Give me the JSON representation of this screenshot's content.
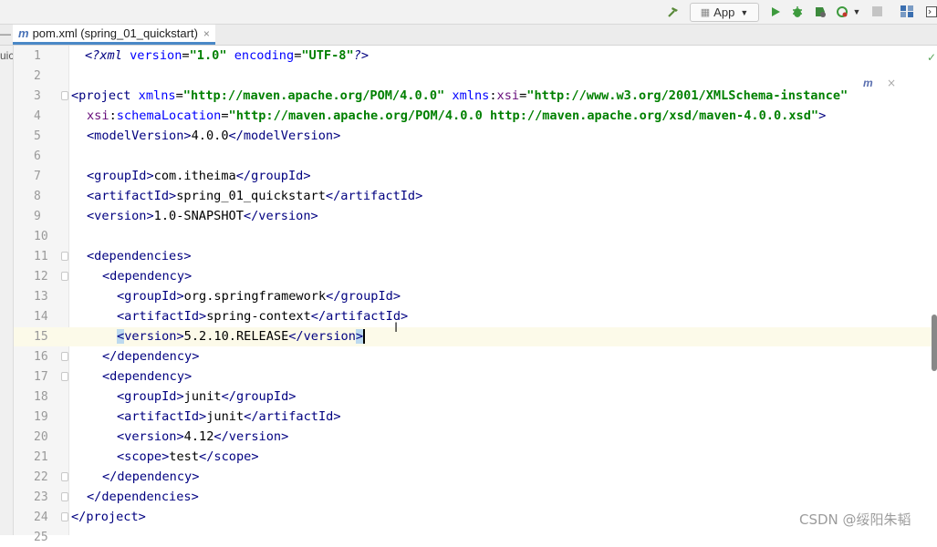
{
  "toolbar": {
    "run_config": "App",
    "icons": [
      "hammer-icon",
      "run-icon",
      "debug-icon",
      "coverage-icon",
      "profile-icon",
      "stop-icon",
      "project-structure-icon",
      "terminal-icon"
    ]
  },
  "tab": {
    "icon_letter": "m",
    "title": "pom.xml (spring_01_quickstart)",
    "close": "×"
  },
  "strip": {
    "label": "uic"
  },
  "overlay": {
    "maven_badge": "m",
    "badge_close": "×",
    "check": "✓"
  },
  "watermark": "CSDN @绥阳朱韬",
  "lines": [
    "1",
    "2",
    "3",
    "4",
    "5",
    "6",
    "7",
    "8",
    "9",
    "10",
    "11",
    "12",
    "13",
    "14",
    "15",
    "16",
    "17",
    "18",
    "19",
    "20",
    "21",
    "22",
    "23",
    "24",
    "25"
  ],
  "code": {
    "xml_decl_version": "\"1.0\"",
    "xml_decl_encoding": "\"UTF-8\"",
    "xmlns": "\"http://maven.apache.org/POM/4.0.0\"",
    "xmlns_xsi": "\"http://www.w3.org/2001/XMLSchema-instance\"",
    "schema_location": "\"http://maven.apache.org/POM/4.0.0 http://maven.apache.org/xsd/maven-4.0.0.xsd\"",
    "model_version": "4.0.0",
    "group_id": "com.itheima",
    "artifact_id": "spring_01_quickstart",
    "version": "1.0-SNAPSHOT",
    "dep1_group": "org.springframework",
    "dep1_artifact": "spring-context",
    "dep1_version": "5.2.10.RELEASE",
    "dep2_group": "junit",
    "dep2_artifact": "junit",
    "dep2_version": "4.12",
    "dep2_scope": "test"
  }
}
